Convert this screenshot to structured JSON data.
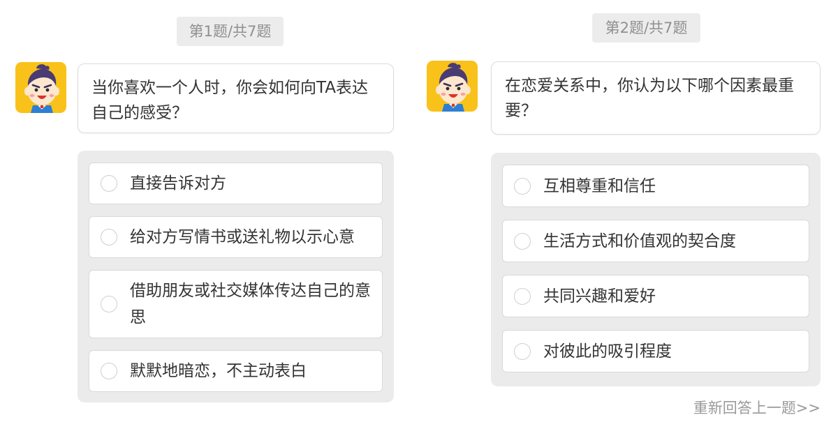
{
  "panels": [
    {
      "progress": "第1题/共7题",
      "question": "当你喜欢一个人时，你会如何向TA表达自己的感受？",
      "options": [
        "直接告诉对方",
        "给对方写情书或送礼物以示心意",
        "借助朋友或社交媒体传达自己的意思",
        "默默地暗恋，不主动表白"
      ]
    },
    {
      "progress": "第2题/共7题",
      "question": "在恋爱关系中，你认为以下哪个因素最重要？",
      "options": [
        "互相尊重和信任",
        "生活方式和价值观的契合度",
        "共同兴趣和爱好",
        "对彼此的吸引程度"
      ],
      "redo_link": "重新回答上一题>>"
    }
  ],
  "colors": {
    "avatar_background": "#f9c21a",
    "progress_background": "#ececec",
    "options_background": "#ebebeb",
    "link_text": "#9a9a9a"
  },
  "icons": {
    "avatar": "cartoon-boy-avatar-icon",
    "radio": "radio-unchecked-icon"
  }
}
